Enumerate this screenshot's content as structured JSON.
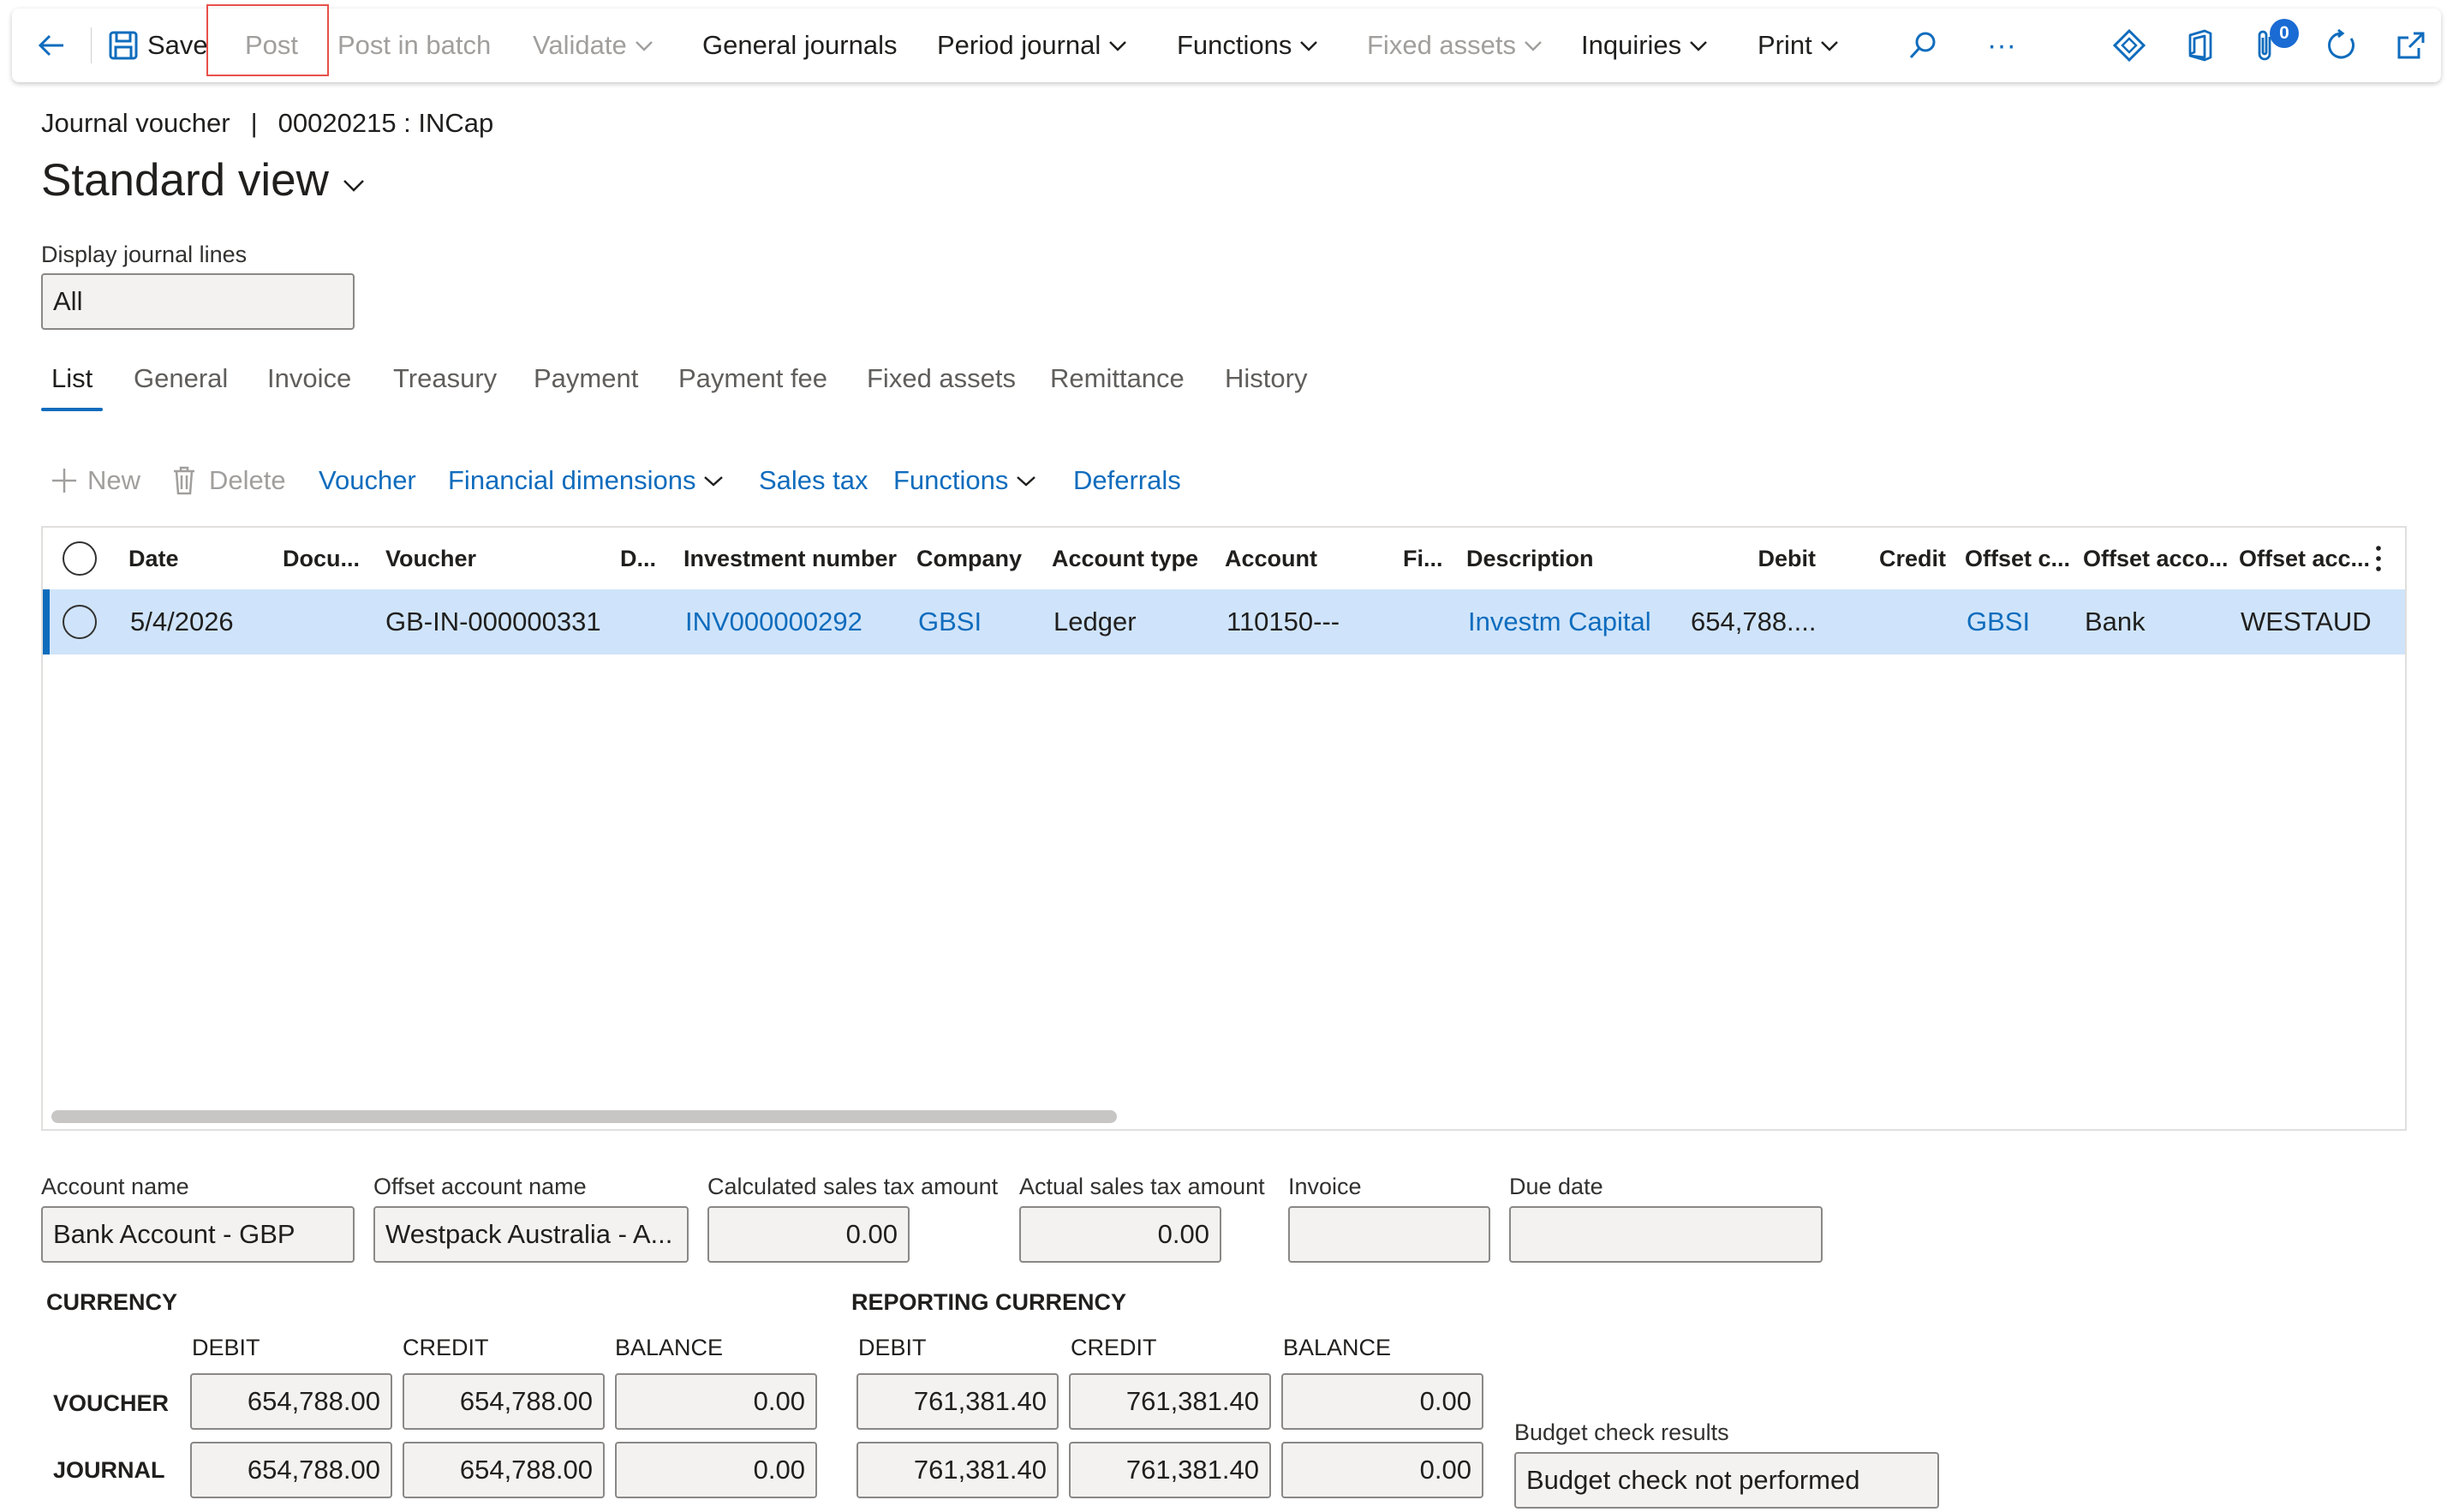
{
  "toolbar": {
    "save_label": "Save",
    "post_label": "Post",
    "post_in_batch_label": "Post in batch",
    "validate_label": "Validate",
    "general_journals_label": "General journals",
    "period_journal_label": "Period journal",
    "functions_label": "Functions",
    "fixed_assets_label": "Fixed assets",
    "inquiries_label": "Inquiries",
    "print_label": "Print",
    "more_label": "···",
    "attachments_count": "0"
  },
  "header": {
    "record_type": "Journal voucher",
    "separator": "|",
    "record_id": "00020215 : INCap",
    "view_title": "Standard view"
  },
  "display_lines": {
    "label": "Display journal lines",
    "value": "All"
  },
  "tabs": [
    "List",
    "General",
    "Invoice",
    "Treasury",
    "Payment",
    "Payment fee",
    "Fixed assets",
    "Remittance",
    "History"
  ],
  "grid_toolbar": {
    "new_label": "New",
    "delete_label": "Delete",
    "voucher_label": "Voucher",
    "financial_dimensions_label": "Financial dimensions",
    "sales_tax_label": "Sales tax",
    "functions_label": "Functions",
    "deferrals_label": "Deferrals"
  },
  "grid": {
    "columns": [
      "Date",
      "Docu...",
      "Voucher",
      "D...",
      "Investment number",
      "Company",
      "Account type",
      "Account",
      "Fi...",
      "Description",
      "Debit",
      "Credit",
      "Offset c...",
      "Offset acco...",
      "Offset acc..."
    ],
    "rows": [
      {
        "date": "5/4/2026",
        "voucher": "GB-IN-000000331",
        "investment_number": "INV000000292",
        "company": "GBSI",
        "account_type": "Ledger",
        "account": "110150---",
        "description": "Investm Capital",
        "debit": "654,788....",
        "offset_company": "GBSI",
        "offset_account_type": "Bank",
        "offset_account": "WESTAUD"
      }
    ]
  },
  "details": {
    "account_name_label": "Account name",
    "account_name": "Bank Account - GBP",
    "offset_account_name_label": "Offset account name",
    "offset_account_name": "Westpack Australia - A...",
    "calc_tax_label": "Calculated sales tax amount",
    "calc_tax": "0.00",
    "actual_tax_label": "Actual sales tax amount",
    "actual_tax": "0.00",
    "invoice_label": "Invoice",
    "invoice": "",
    "due_date_label": "Due date",
    "due_date": ""
  },
  "currency": {
    "title": "CURRENCY",
    "debit_label": "DEBIT",
    "credit_label": "CREDIT",
    "balance_label": "BALANCE",
    "voucher_label": "VOUCHER",
    "journal_label": "JOURNAL",
    "voucher": {
      "debit": "654,788.00",
      "credit": "654,788.00",
      "balance": "0.00"
    },
    "journal": {
      "debit": "654,788.00",
      "credit": "654,788.00",
      "balance": "0.00"
    }
  },
  "reporting_currency": {
    "title": "REPORTING CURRENCY",
    "debit_label": "DEBIT",
    "credit_label": "CREDIT",
    "balance_label": "BALANCE",
    "voucher": {
      "debit": "761,381.40",
      "credit": "761,381.40",
      "balance": "0.00"
    },
    "journal": {
      "debit": "761,381.40",
      "credit": "761,381.40",
      "balance": "0.00"
    }
  },
  "budget": {
    "label": "Budget check results",
    "value": "Budget check not performed"
  },
  "colors": {
    "accent": "#0f6cbd",
    "selected_row": "#cfe4fa",
    "highlight_box": "#e8504a"
  }
}
